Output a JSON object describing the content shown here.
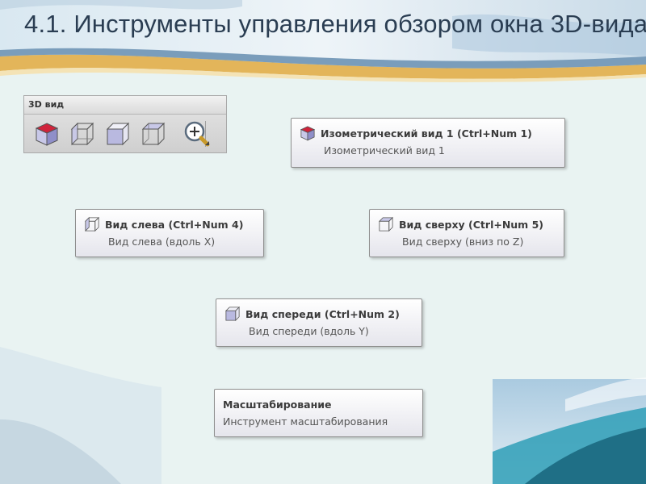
{
  "slide": {
    "title": "4.1. Инструменты управления обзором окна 3D-вида"
  },
  "ribbon": {
    "group_label": "3D вид",
    "buttons": [
      {
        "icon": "isometric-cube-icon"
      },
      {
        "icon": "left-view-cube-icon"
      },
      {
        "icon": "front-view-cube-icon"
      },
      {
        "icon": "top-view-cube-icon"
      },
      {
        "icon": "zoom-magnifier-icon"
      }
    ]
  },
  "tooltips": {
    "isometric": {
      "title": "Изометрический вид 1 (Ctrl+Num 1)",
      "desc": "Изометрический вид 1"
    },
    "left": {
      "title": "Вид слева (Ctrl+Num 4)",
      "desc": "Вид слева (вдоль X)"
    },
    "top": {
      "title": "Вид сверху (Ctrl+Num 5)",
      "desc": "Вид сверху (вниз по Z)"
    },
    "front": {
      "title": "Вид спереди (Ctrl+Num 2)",
      "desc": "Вид спереди (вдоль Y)"
    },
    "zoom": {
      "title": "Масштабирование",
      "desc": "Инструмент масштабирования"
    }
  },
  "colors": {
    "title_text": "#2a3d52",
    "background": "#e9f3f2",
    "accent_red": "#d0233b",
    "cube_fill": "#8f8fc9"
  }
}
